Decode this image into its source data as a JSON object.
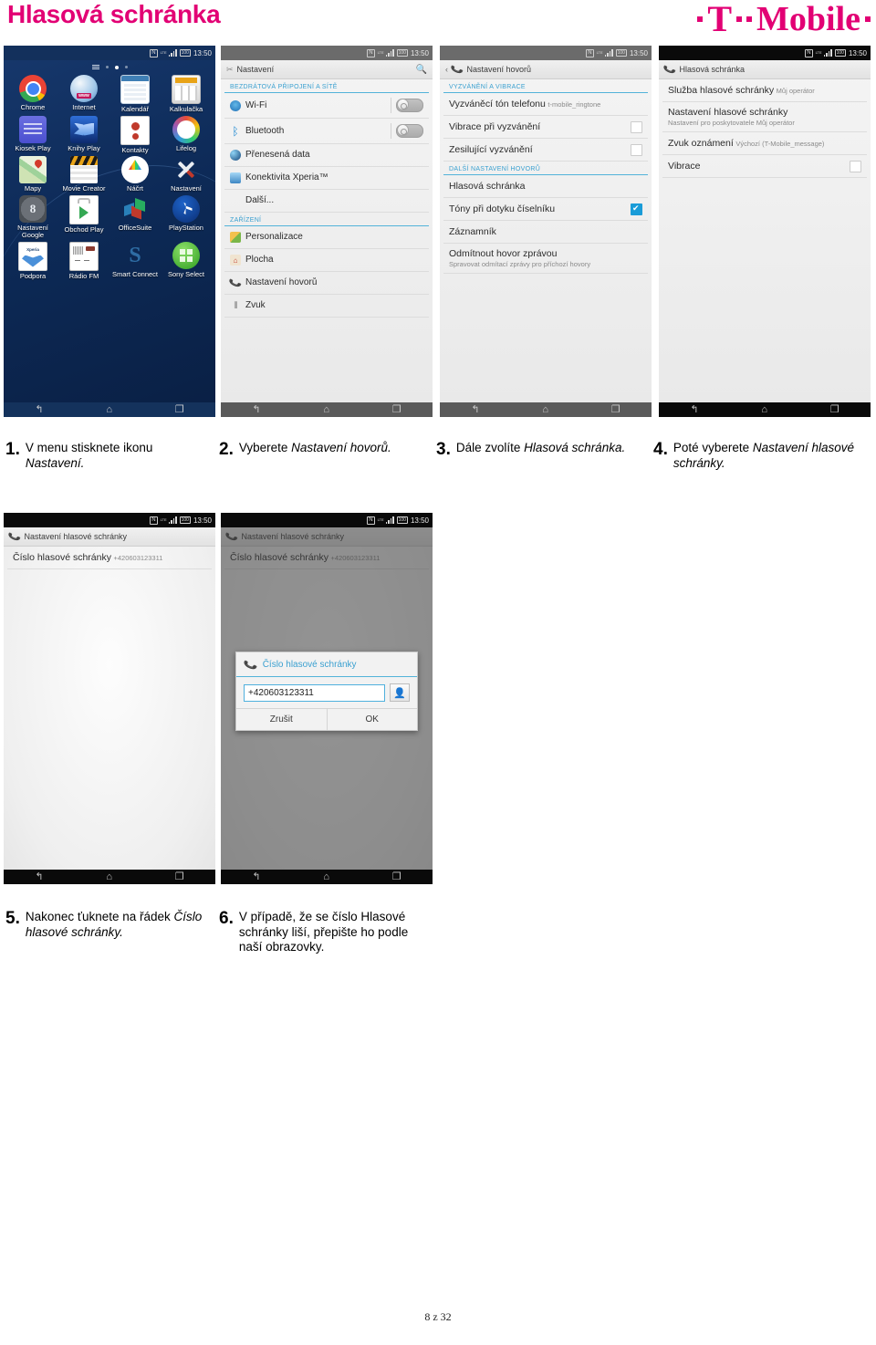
{
  "header": {
    "title": "Hlasová schránka",
    "brand": {
      "t": "T",
      "word": "Mobile"
    },
    "title_color": "#e20074"
  },
  "status_bar": {
    "nfc": "N",
    "lte": "LTE",
    "battery": "100",
    "time": "13:50"
  },
  "nav_bar": {
    "back": "back-icon",
    "home": "home-icon",
    "recents": "recents-icon"
  },
  "screens": {
    "home": {
      "apps": [
        {
          "label": "Chrome",
          "icon": "chrome-icon"
        },
        {
          "label": "Internet",
          "icon": "internet-icon"
        },
        {
          "label": "Kalendář",
          "icon": "calendar-icon"
        },
        {
          "label": "Kalkulačka",
          "icon": "calculator-icon"
        },
        {
          "label": "Kiosek Play",
          "icon": "play-newsstand-icon"
        },
        {
          "label": "Knihy Play",
          "icon": "play-books-icon"
        },
        {
          "label": "Kontakty",
          "icon": "contacts-icon"
        },
        {
          "label": "Lifelog",
          "icon": "lifelog-icon"
        },
        {
          "label": "Mapy",
          "icon": "maps-icon"
        },
        {
          "label": "Movie Creator",
          "icon": "movie-creator-icon"
        },
        {
          "label": "Náčrt",
          "icon": "sketch-icon"
        },
        {
          "label": "Nastavení",
          "icon": "settings-icon"
        },
        {
          "label": "Nastavení Google",
          "icon": "google-settings-icon"
        },
        {
          "label": "Obchod Play",
          "icon": "play-store-icon"
        },
        {
          "label": "OfficeSuite",
          "icon": "officesuite-icon"
        },
        {
          "label": "PlayStation",
          "icon": "playstation-icon"
        },
        {
          "label": "Podpora",
          "icon": "support-icon"
        },
        {
          "label": "Rádio FM",
          "icon": "fm-radio-icon"
        },
        {
          "label": "Smart Connect",
          "icon": "smart-connect-icon"
        },
        {
          "label": "Sony Select",
          "icon": "sony-select-icon"
        }
      ]
    },
    "settings": {
      "title": "Nastavení",
      "search_icon": "search-icon",
      "sections": [
        {
          "header": "BEZDRÁTOVÁ PŘIPOJENÍ A SÍTĚ",
          "rows": [
            {
              "title": "Wi-Fi",
              "icon": "wifi-icon",
              "control": "toggle-off"
            },
            {
              "title": "Bluetooth",
              "icon": "bluetooth-icon",
              "control": "toggle-off"
            },
            {
              "title": "Přenesená data",
              "icon": "data-usage-icon",
              "control": "none"
            },
            {
              "title": "Konektivita Xperia™",
              "icon": "xperia-connectivity-icon",
              "control": "none"
            },
            {
              "title": "Další...",
              "icon": "none",
              "control": "none"
            }
          ]
        },
        {
          "header": "ZAŘÍZENÍ",
          "rows": [
            {
              "title": "Personalizace",
              "icon": "personalization-icon",
              "control": "none"
            },
            {
              "title": "Plocha",
              "icon": "home-screen-icon",
              "control": "none"
            },
            {
              "title": "Nastavení hovorů",
              "icon": "call-settings-icon",
              "control": "none"
            },
            {
              "title": "Zvuk",
              "icon": "sound-icon",
              "control": "none"
            }
          ]
        }
      ]
    },
    "call_settings": {
      "title": "Nastavení hovorů",
      "back_icon": "back-chevron-icon",
      "sections": [
        {
          "header": "VYZVÁNĚNÍ A VIBRACE",
          "rows": [
            {
              "title": "Vyzváněcí tón telefonu",
              "sub": "t-mobile_ringtone",
              "control": "none"
            },
            {
              "title": "Vibrace při vyzvánění",
              "sub": "",
              "control": "checkbox-off"
            },
            {
              "title": "Zesilující vyzvánění",
              "sub": "",
              "control": "checkbox-off"
            }
          ]
        },
        {
          "header": "DALŠÍ NASTAVENÍ HOVORŮ",
          "rows": [
            {
              "title": "Hlasová schránka",
              "sub": "",
              "control": "none"
            },
            {
              "title": "Tóny při dotyku číselníku",
              "sub": "",
              "control": "checkbox-on"
            },
            {
              "title": "Záznamník",
              "sub": "",
              "control": "none"
            },
            {
              "title": "Odmítnout hovor zprávou",
              "sub": "Spravovat odmítací zprávy pro příchozí hovory",
              "control": "none"
            }
          ]
        }
      ]
    },
    "voicemail": {
      "title": "Hlasová schránka",
      "rows": [
        {
          "title": "Služba hlasové schránky",
          "sub": "Můj operátor",
          "control": "none"
        },
        {
          "title": "Nastavení hlasové schránky",
          "sub": "Nastavení pro poskytovatele Můj operátor",
          "control": "none"
        },
        {
          "title": "Zvuk oznámení",
          "sub": "Výchozí (T-Mobile_message)",
          "control": "none"
        },
        {
          "title": "Vibrace",
          "sub": "",
          "control": "checkbox-off"
        }
      ]
    },
    "voicemail_settings": {
      "title": "Nastavení hlasové schránky",
      "rows": [
        {
          "title": "Číslo hlasové schránky",
          "sub": "+420603123311"
        }
      ]
    },
    "voicemail_dialog": {
      "title": "Nastavení hlasové schránky",
      "rows": [
        {
          "title": "Číslo hlasové schránky",
          "sub": "+420603123311"
        }
      ],
      "dialog": {
        "title": "Číslo hlasové schránky",
        "phone_icon": "phone-icon",
        "input_value": "+420603123311",
        "contact_icon": "contact-picker-icon",
        "cancel_label": "Zrušit",
        "ok_label": "OK"
      }
    }
  },
  "steps": [
    {
      "num": "1.",
      "html": "V menu stisknete ikonu <em>Nastavení.</em>"
    },
    {
      "num": "2.",
      "html": "Vyberete <em>Nastavení hovorů.</em>"
    },
    {
      "num": "3.",
      "html": "Dále zvolíte <em>Hlasová schránka.</em>"
    },
    {
      "num": "4.",
      "html": "Poté vyberete <em>Nastavení hlasové schránky.</em>"
    },
    {
      "num": "5.",
      "html": "Nakonec ťuknete na řádek <em>Číslo hlasové schránky.</em>"
    },
    {
      "num": "6.",
      "html": "V případě, že se číslo Hlasové schránky liší, přepište ho podle naší obrazovky."
    }
  ],
  "footer": {
    "page": "8 z 32"
  }
}
